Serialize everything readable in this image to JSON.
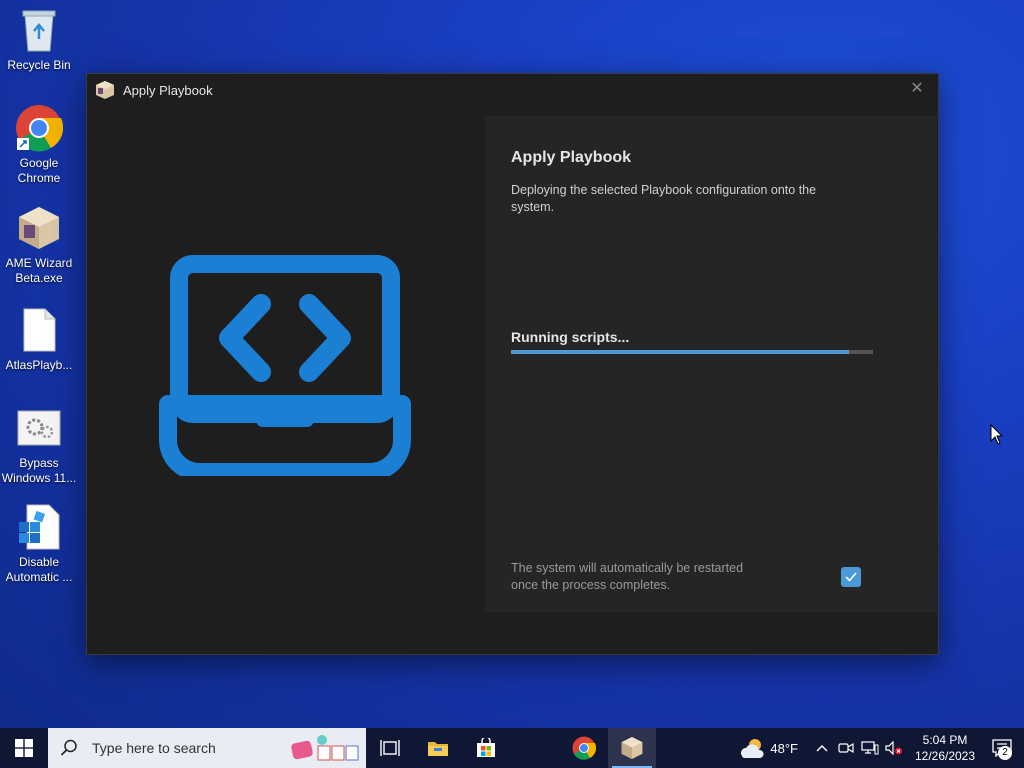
{
  "desktop": {
    "icons": [
      {
        "label": "Recycle Bin"
      },
      {
        "label": "Google\nChrome"
      },
      {
        "label": "AME Wizard\nBeta.exe"
      },
      {
        "label": "AtlasPlayb..."
      },
      {
        "label": "Bypass\nWindows 11..."
      },
      {
        "label": "Disable\nAutomatic ..."
      }
    ]
  },
  "window": {
    "title": "Apply Playbook",
    "close_glyph": "✕",
    "panel": {
      "heading": "Apply Playbook",
      "description": "Deploying the selected Playbook configuration onto the system.",
      "status": "Running scripts...",
      "progress_fraction": 0.935,
      "note": "The system will automatically be restarted once the process completes.",
      "restart_checkbox_checked": true
    }
  },
  "taskbar": {
    "search_placeholder": "Type here to search",
    "weather_temp": "48°F",
    "time": "5:04 PM",
    "date": "12/26/2023",
    "notification_count": "2"
  },
  "colors": {
    "accent": "#4a9ad8",
    "hero_icon": "#1b7fd4",
    "taskbar": "#101735",
    "window_bg": "#1e1e1e",
    "panel_bg": "#252525"
  },
  "icons": [
    "recycle-bin-icon",
    "chrome-icon",
    "ame-wizard-icon",
    "file-icon",
    "bypass-icon",
    "disable-icon",
    "laptop-code-icon",
    "windows-logo-icon",
    "search-icon",
    "task-view-icon",
    "file-explorer-icon",
    "store-icon",
    "weather-icon",
    "chevron-up-icon",
    "meet-icon",
    "network-icon",
    "volume-muted-icon",
    "notification-icon"
  ]
}
